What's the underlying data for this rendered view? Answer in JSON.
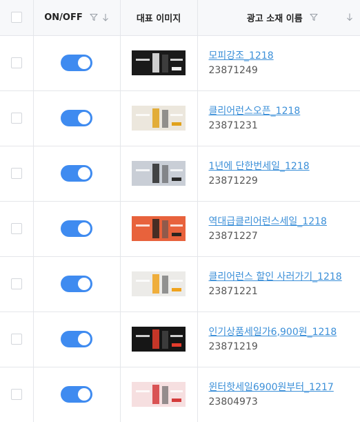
{
  "header": {
    "toggle_label": "ON/OFF",
    "image_label": "대표 이미지",
    "name_label": "광고 소재 이름"
  },
  "rows": [
    {
      "on": true,
      "name": "모피강조_1218",
      "id": "23871249",
      "thumb_colors": [
        "#1a1a1a",
        "#f0f0f0"
      ]
    },
    {
      "on": true,
      "name": "클리어런스오픈_1218",
      "id": "23871231",
      "thumb_colors": [
        "#ece7dd",
        "#e0a21c"
      ]
    },
    {
      "on": true,
      "name": "1년에 단한번세일_1218",
      "id": "23871229",
      "thumb_colors": [
        "#c9ced6",
        "#2a2a2a"
      ]
    },
    {
      "on": true,
      "name": "역대급클리어런스세일_1218",
      "id": "23871227",
      "thumb_colors": [
        "#e8623c",
        "#2b2520"
      ]
    },
    {
      "on": true,
      "name": "클리어런스 할인 사러가기_1218",
      "id": "23871221",
      "thumb_colors": [
        "#ecebe8",
        "#f0a31d"
      ]
    },
    {
      "on": true,
      "name": "인기상품세일가6,900원_1218",
      "id": "23871219",
      "thumb_colors": [
        "#161616",
        "#e33c2c"
      ]
    },
    {
      "on": true,
      "name": "윈터핫세일6900원부터_1217",
      "id": "23804973",
      "thumb_colors": [
        "#f6dfe0",
        "#d43b3b"
      ]
    }
  ]
}
